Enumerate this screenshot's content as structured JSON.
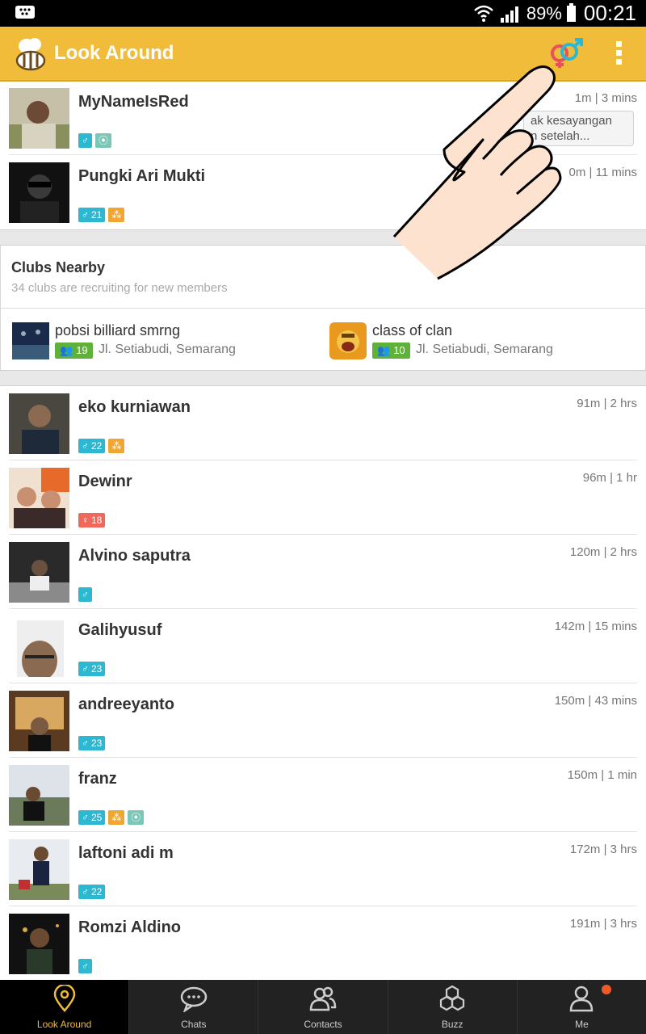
{
  "status_bar": {
    "battery": "89%",
    "time": "00:21"
  },
  "app_bar": {
    "title": "Look Around"
  },
  "people_top": [
    {
      "name": "MyNameIsRed",
      "meta": "1m | 3 mins",
      "gender": "male",
      "age": "",
      "group": false,
      "location": true
    },
    {
      "name": "Pungki Ari Mukti",
      "meta": "0m | 11 mins",
      "gender": "male",
      "age": "21",
      "group": true,
      "location": false
    }
  ],
  "tooltip": {
    "line1": "ak kesayangan",
    "line2": "n setelah..."
  },
  "clubs": {
    "title": "Clubs Nearby",
    "subtitle": "34 clubs are recruiting for new members",
    "items": [
      {
        "name": "pobsi billiard smrng",
        "members": "19",
        "location": "Jl. Setiabudi, Semarang"
      },
      {
        "name": "class of clan",
        "members": "10",
        "location": "Jl. Setiabudi, Semarang"
      }
    ]
  },
  "people": [
    {
      "name": "eko kurniawan",
      "meta": "91m | 2 hrs",
      "gender": "male",
      "age": "22",
      "group": true,
      "location": false
    },
    {
      "name": "Dewinr",
      "meta": "96m | 1 hr",
      "gender": "female",
      "age": "18",
      "group": false,
      "location": false
    },
    {
      "name": "Alvino saputra",
      "meta": "120m | 2 hrs",
      "gender": "male",
      "age": "",
      "group": false,
      "location": false
    },
    {
      "name": "Galihyusuf",
      "meta": "142m | 15 mins",
      "gender": "male",
      "age": "23",
      "group": false,
      "location": false
    },
    {
      "name": "andreeyanto",
      "meta": "150m | 43 mins",
      "gender": "male",
      "age": "23",
      "group": false,
      "location": false
    },
    {
      "name": "franz",
      "meta": "150m | 1 min",
      "gender": "male",
      "age": "25",
      "group": true,
      "location": true
    },
    {
      "name": "laftoni adi m",
      "meta": "172m | 3 hrs",
      "gender": "male",
      "age": "22",
      "group": false,
      "location": false
    },
    {
      "name": "Romzi Aldino",
      "meta": "191m | 3 hrs",
      "gender": "male",
      "age": "",
      "group": false,
      "location": false
    }
  ],
  "bottom_nav": [
    {
      "label": "Look Around",
      "icon": "location-pin-icon",
      "active": true
    },
    {
      "label": "Chats",
      "icon": "chat-bubble-icon",
      "active": false
    },
    {
      "label": "Contacts",
      "icon": "contacts-icon",
      "active": false
    },
    {
      "label": "Buzz",
      "icon": "buzz-hexagon-icon",
      "active": false
    },
    {
      "label": "Me",
      "icon": "person-icon",
      "active": false
    }
  ],
  "colors": {
    "accent": "#f0bc3a",
    "male": "#2db7d0",
    "female": "#f0685c",
    "group": "#f0a632",
    "club_count": "#5fb13a",
    "notification": "#f05a28"
  }
}
